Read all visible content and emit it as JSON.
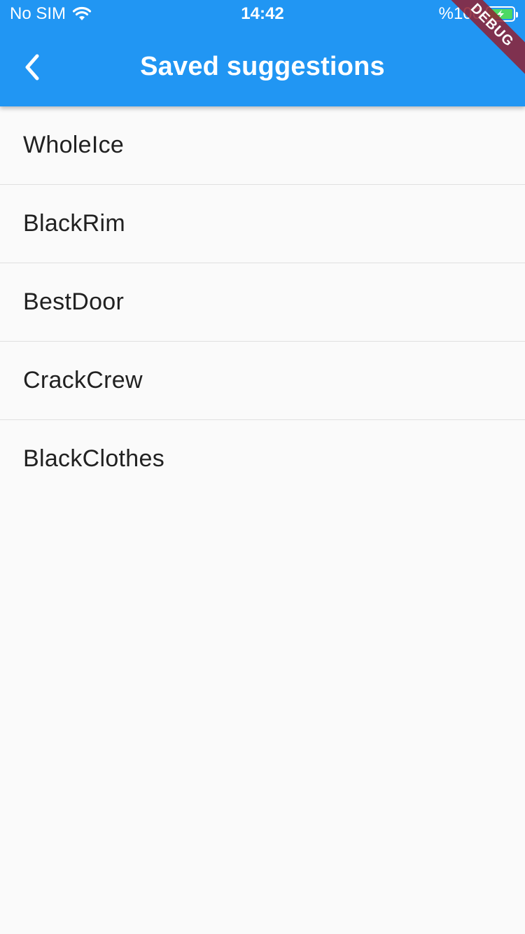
{
  "status_bar": {
    "carrier": "No SIM",
    "time": "14:42",
    "battery_text": "%100",
    "battery_color": "#4cd964"
  },
  "app_bar": {
    "title": "Saved suggestions",
    "back_icon": "chevron-left-icon",
    "background_color": "#2196f3"
  },
  "debug_banner": {
    "label": "DEBUG",
    "color": "#8f2031"
  },
  "saved_suggestions": [
    {
      "label": "WholeIce"
    },
    {
      "label": "BlackRim"
    },
    {
      "label": "BestDoor"
    },
    {
      "label": "CrackCrew"
    },
    {
      "label": "BlackClothes"
    }
  ]
}
